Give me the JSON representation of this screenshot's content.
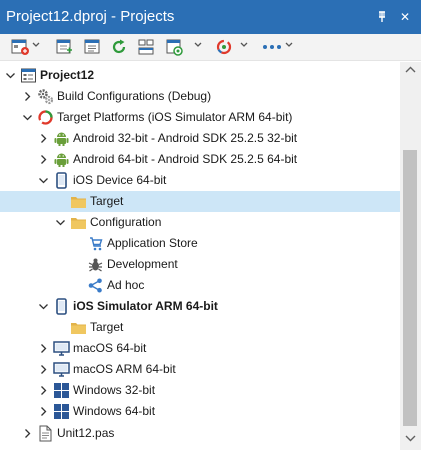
{
  "window": {
    "title": "Project12.dproj - Projects",
    "pin_glyph": "📌",
    "close_glyph": "✕"
  },
  "toolbar": {
    "buttons": [
      {
        "icon": "new-project-icon"
      },
      {
        "icon": "add-icon"
      },
      {
        "icon": "options-icon"
      },
      {
        "icon": "refresh-icon"
      },
      {
        "icon": "build-groups-icon"
      },
      {
        "icon": "deploy-icon"
      },
      {
        "icon": "target-platform-icon"
      },
      {
        "icon": "more-icon"
      }
    ],
    "colors": {
      "accent": "#2b6fb5",
      "green": "#2f9a3b",
      "red": "#e0392b"
    }
  },
  "tree": {
    "project": {
      "label": "Project12"
    },
    "build_configurations": {
      "label": "Build Configurations (Debug)"
    },
    "target_platforms": {
      "label": "Target Platforms (iOS Simulator ARM 64-bit)"
    },
    "android32": {
      "label": "Android 32-bit - Android SDK 25.2.5 32-bit"
    },
    "android64": {
      "label": "Android 64-bit - Android SDK 25.2.5 64-bit"
    },
    "ios_device": {
      "label": "iOS Device 64-bit"
    },
    "ios_target": {
      "label": "Target"
    },
    "configuration": {
      "label": "Configuration"
    },
    "app_store": {
      "label": "Application Store"
    },
    "development": {
      "label": "Development"
    },
    "ad_hoc": {
      "label": "Ad hoc"
    },
    "ios_sim": {
      "label": "iOS Simulator ARM 64-bit"
    },
    "sim_target": {
      "label": "Target"
    },
    "macos64": {
      "label": "macOS 64-bit"
    },
    "macos_arm": {
      "label": "macOS ARM 64-bit"
    },
    "win32": {
      "label": "Windows 32-bit"
    },
    "win64": {
      "label": "Windows 64-bit"
    },
    "unit": {
      "label": "Unit12.pas"
    }
  }
}
